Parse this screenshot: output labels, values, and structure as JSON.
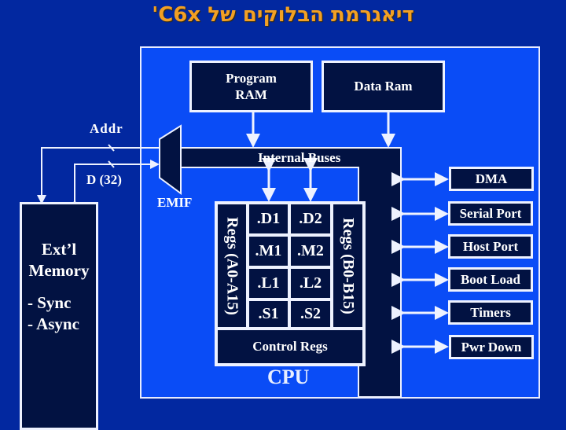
{
  "title": "דיאגרמת הבלוקים של C6x'",
  "colors": {
    "background": "#0228a0",
    "chip": "#0a4cf6",
    "block": "#021242",
    "title": "#f2a024",
    "line": "#eef2ff"
  },
  "memory": {
    "program_ram": [
      "Program",
      "RAM"
    ],
    "data_ram": "Data Ram"
  },
  "buses": {
    "internal": "Internal Buses",
    "addr": "Addr",
    "data": "D (32)",
    "emif": "EMIF"
  },
  "external_memory": {
    "title_line1": "Ext’l",
    "title_line2": "Memory",
    "items": [
      "- Sync",
      "- Async"
    ]
  },
  "cpu": {
    "label": "CPU",
    "regs_a": "Regs (A0-A15)",
    "regs_b": "Regs (B0-B15)",
    "units": [
      [
        ".D1",
        ".D2"
      ],
      [
        ".M1",
        ".M2"
      ],
      [
        ".L1",
        ".L2"
      ],
      [
        ".S1",
        ".S2"
      ]
    ],
    "control_regs": "Control Regs"
  },
  "peripherals": [
    "DMA",
    "Serial Port",
    "Host Port",
    "Boot Load",
    "Timers",
    "Pwr Down"
  ]
}
